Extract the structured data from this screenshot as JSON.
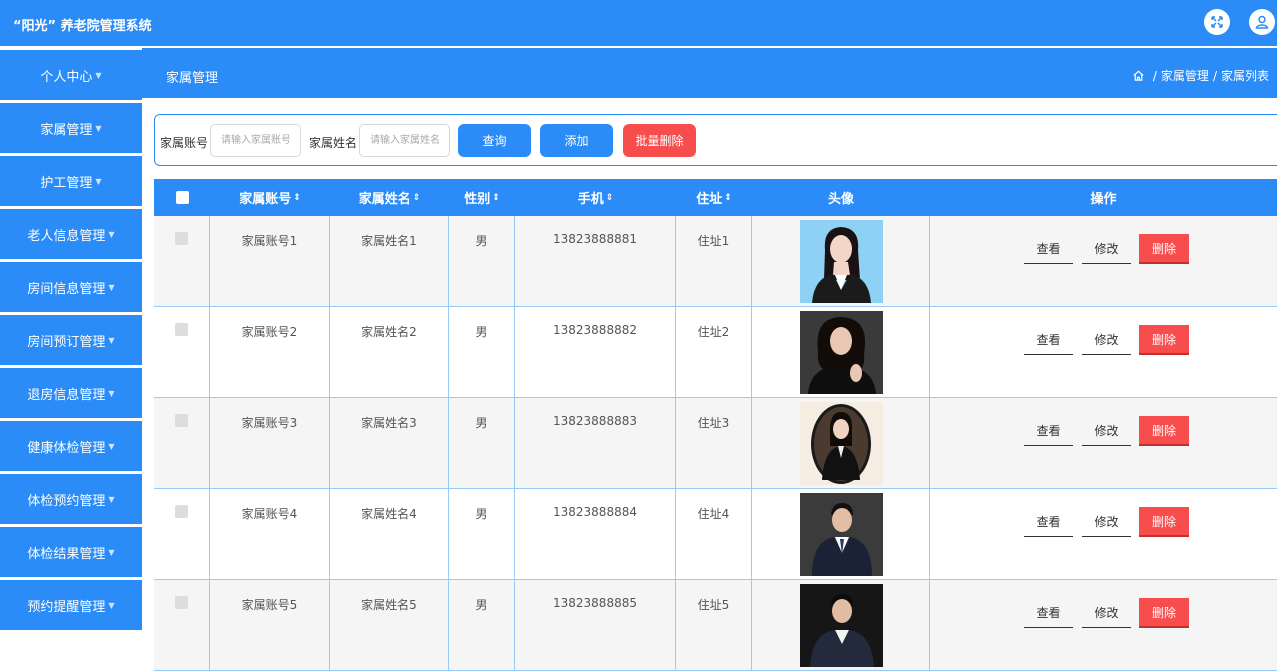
{
  "header": {
    "brand": "“阳光” 养老院管理系统",
    "fullscreen_icon": "fullscreen-icon",
    "user_icon": "user-icon"
  },
  "sidebar": {
    "items": [
      {
        "label": "个人中心"
      },
      {
        "label": "家属管理"
      },
      {
        "label": "护工管理"
      },
      {
        "label": "老人信息管理"
      },
      {
        "label": "房间信息管理"
      },
      {
        "label": "房间预订管理"
      },
      {
        "label": "退房信息管理"
      },
      {
        "label": "健康体检管理"
      },
      {
        "label": "体检预约管理"
      },
      {
        "label": "体检结果管理"
      },
      {
        "label": "预约提醒管理"
      }
    ]
  },
  "breadcrumb": {
    "title": "家属管理",
    "home_icon": "home-icon",
    "path": [
      "家属管理",
      "家属列表"
    ],
    "separator": "/"
  },
  "search": {
    "account_label": "家属账号",
    "account_placeholder": "请输入家属账号",
    "name_label": "家属姓名",
    "name_placeholder": "请输入家属姓名",
    "query_label": "查询",
    "add_label": "添加",
    "batch_delete_label": "批量删除"
  },
  "table": {
    "columns": [
      "家属账号",
      "家属姓名",
      "性别",
      "手机",
      "住址",
      "头像",
      "操作"
    ],
    "sort_symbol": "⇕",
    "actions": {
      "view": "查看",
      "edit": "修改",
      "delete": "删除"
    },
    "rows": [
      {
        "account": "家属账号1",
        "name": "家属姓名1",
        "gender": "男",
        "phone": "13823888881",
        "address": "住址1"
      },
      {
        "account": "家属账号2",
        "name": "家属姓名2",
        "gender": "男",
        "phone": "13823888882",
        "address": "住址2"
      },
      {
        "account": "家属账号3",
        "name": "家属姓名3",
        "gender": "男",
        "phone": "13823888883",
        "address": "住址3"
      },
      {
        "account": "家属账号4",
        "name": "家属姓名4",
        "gender": "男",
        "phone": "13823888884",
        "address": "住址4"
      },
      {
        "account": "家属账号5",
        "name": "家属姓名5",
        "gender": "男",
        "phone": "13823888885",
        "address": "住址5"
      }
    ]
  },
  "colors": {
    "primary": "#2b8cf7",
    "danger": "#f74d4d",
    "row_border": "#9ccaf8"
  }
}
